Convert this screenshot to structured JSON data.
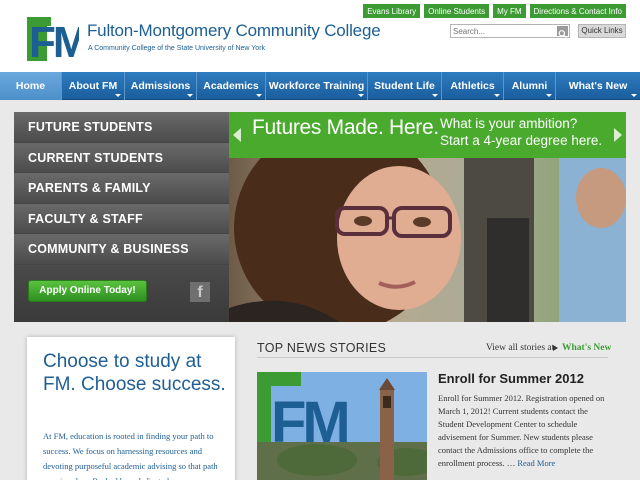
{
  "header": {
    "college_name": "Fulton-Montgomery Community College",
    "college_sub": "A Community College of the State University of New York",
    "logo_text": "FM",
    "top_links": [
      "Evans Library",
      "Online Students",
      "My FM",
      "Directions & Contact Info"
    ],
    "search_placeholder": "Search...",
    "quick_links_label": "Quick Links"
  },
  "nav": {
    "items": [
      {
        "label": "Home"
      },
      {
        "label": "About FM"
      },
      {
        "label": "Admissions"
      },
      {
        "label": "Academics"
      },
      {
        "label": "Workforce Training"
      },
      {
        "label": "Student Life"
      },
      {
        "label": "Athletics"
      },
      {
        "label": "Alumni"
      },
      {
        "label": "What's New"
      }
    ]
  },
  "side_menu": {
    "items": [
      "FUTURE STUDENTS",
      "CURRENT STUDENTS",
      "PARENTS & FAMILY",
      "FACULTY & STAFF",
      "COMMUNITY & BUSINESS"
    ],
    "apply_label": "Apply Online Today!",
    "facebook_glyph": "f"
  },
  "banner": {
    "title": "Futures Made. Here.",
    "sub_line1": "What is your ambition?",
    "sub_line2": "Start a 4-year degree here."
  },
  "choose": {
    "title": "Choose to study at FM. Choose success.",
    "body": "At FM, education is rooted in finding your path to success. We focus on harnessing resources and devoting purposeful academic advising so that path remains clear. Backed by a dedicated"
  },
  "news": {
    "heading": "TOP NEWS STORIES",
    "view_all": "View all stories at",
    "whats_new": "What's New",
    "story_title": "Enroll for Summer 2012",
    "story_body": "Enroll for Summer 2012.  Registration opened on March 1, 2012!  Current students contact the Student Development Center to schedule advisement for Summer.  New students please contact the Admissions office to complete the enrollment process.  …",
    "read_more": "Read More"
  },
  "colors": {
    "brand_blue": "#1d5f93",
    "brand_green": "#3c9c33",
    "nav_blue": "#1a5e9e"
  }
}
